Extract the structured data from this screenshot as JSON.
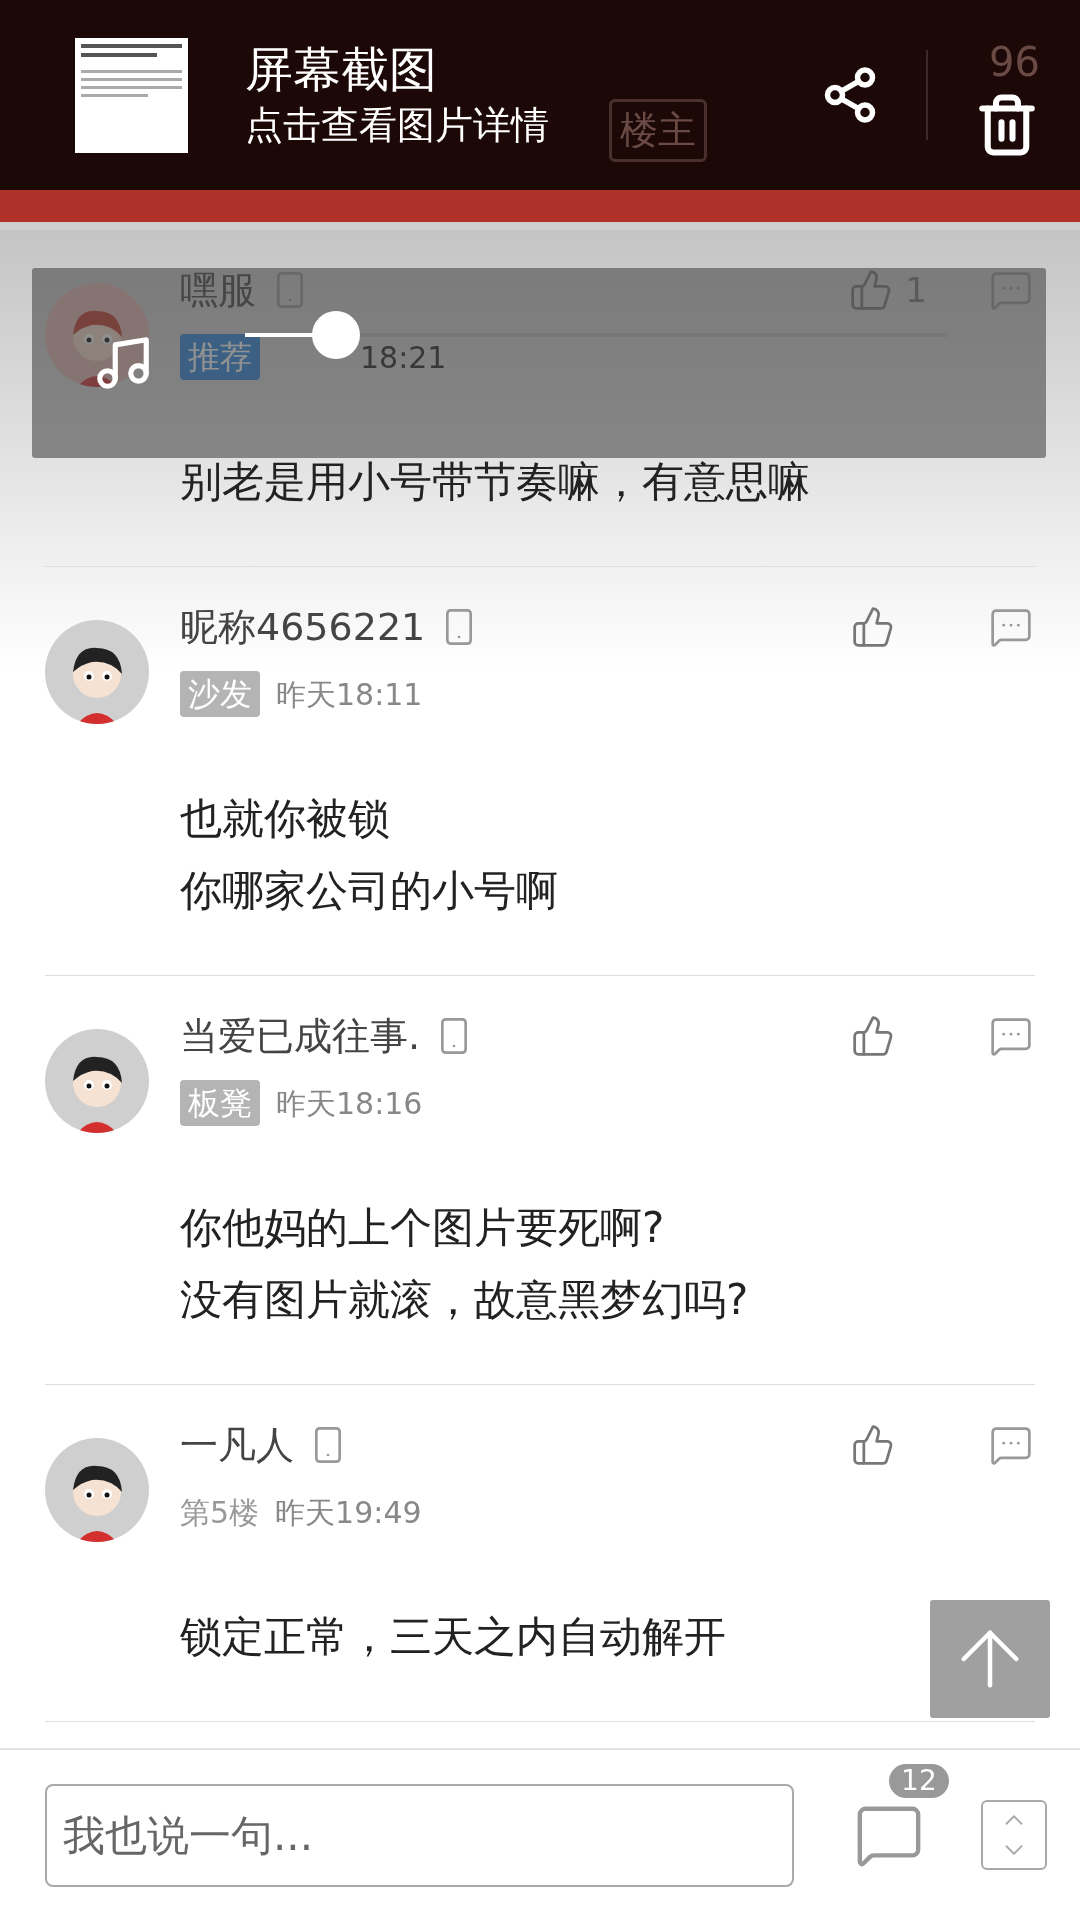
{
  "status_bar": {
    "battery": "96"
  },
  "nav": {
    "op_button": "楼主"
  },
  "notification": {
    "title": "屏幕截图",
    "subtitle": "点击查看图片详情"
  },
  "music_player": {
    "level": 0.13
  },
  "posts": [
    {
      "name": "嘿服",
      "badge": {
        "kind": "featured",
        "text": "推荐"
      },
      "time": "18:21",
      "likes": "1",
      "body": [
        "别老是用小号带节奏嘛，有意思嘛"
      ]
    },
    {
      "name": "昵称4656221",
      "badge": {
        "kind": "tag",
        "text": "沙发"
      },
      "time": "昨天18:11",
      "body": [
        "也就你被锁",
        "你哪家公司的小号啊"
      ]
    },
    {
      "name": "当爱已成往事.",
      "badge": {
        "kind": "tag",
        "text": "板凳"
      },
      "time": "昨天18:16",
      "body": [
        "你他妈的上个图片要死啊?",
        "没有图片就滚，故意黑梦幻吗?"
      ]
    },
    {
      "name": "一凡人",
      "badge": {
        "kind": "floor",
        "text": "第5楼"
      },
      "time": "昨天19:49",
      "body": [
        "锁定正常，三天之内自动解开"
      ]
    }
  ],
  "reply_bar": {
    "placeholder": "我也说一句...",
    "comment_count": "12"
  }
}
